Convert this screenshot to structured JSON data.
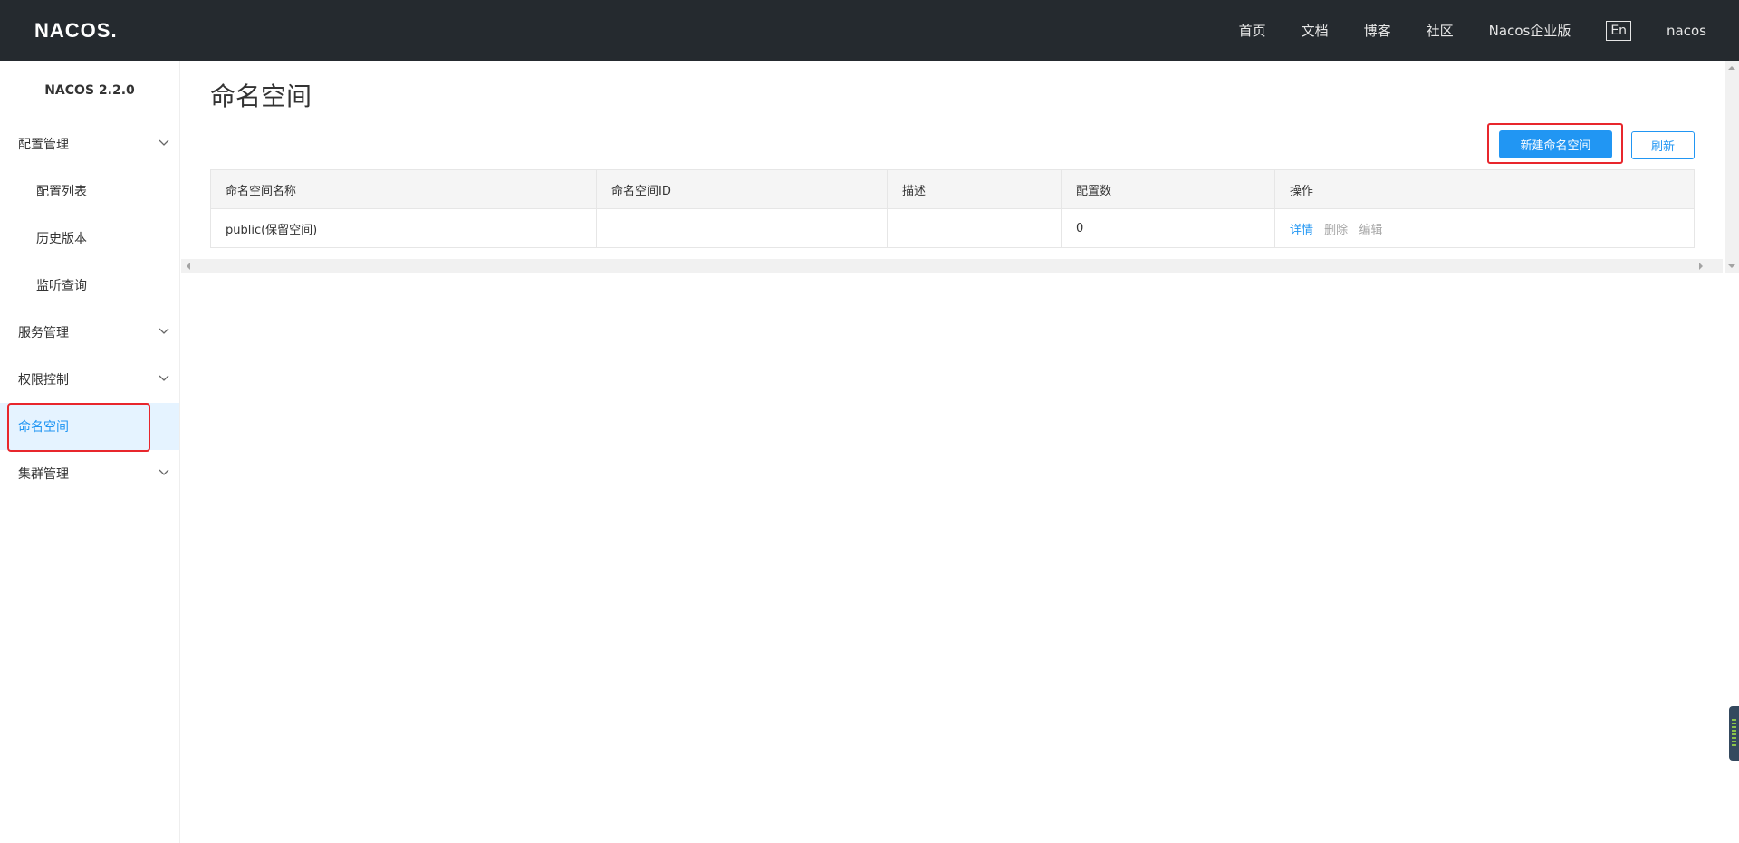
{
  "header": {
    "logo_text": "NACOS.",
    "nav": [
      {
        "label": "首页"
      },
      {
        "label": "文档"
      },
      {
        "label": "博客"
      },
      {
        "label": "社区"
      },
      {
        "label": "Nacos企业版"
      },
      {
        "label": "En"
      },
      {
        "label": "nacos"
      }
    ]
  },
  "sidebar": {
    "version": "NACOS 2.2.0",
    "items": [
      {
        "label": "配置管理",
        "type": "group",
        "expanded": true
      },
      {
        "label": "配置列表",
        "type": "sub"
      },
      {
        "label": "历史版本",
        "type": "sub"
      },
      {
        "label": "监听查询",
        "type": "sub"
      },
      {
        "label": "服务管理",
        "type": "group",
        "expanded": false
      },
      {
        "label": "权限控制",
        "type": "group",
        "expanded": false
      },
      {
        "label": "命名空间",
        "type": "item",
        "active": true
      },
      {
        "label": "集群管理",
        "type": "group",
        "expanded": false
      }
    ]
  },
  "main": {
    "title": "命名空间",
    "create_button": "新建命名空间",
    "refresh_button": "刷新",
    "table": {
      "columns": [
        "命名空间名称",
        "命名空间ID",
        "描述",
        "配置数",
        "操作"
      ],
      "rows": [
        {
          "name": "public(保留空间)",
          "id": "",
          "description": "",
          "config_count": "0",
          "actions": [
            "详情",
            "删除",
            "编辑"
          ]
        }
      ]
    }
  },
  "colors": {
    "header_bg": "#252a2f",
    "accent": "#2196f3",
    "active_bg": "#e5f3ff",
    "highlight_border": "#e8262c"
  }
}
